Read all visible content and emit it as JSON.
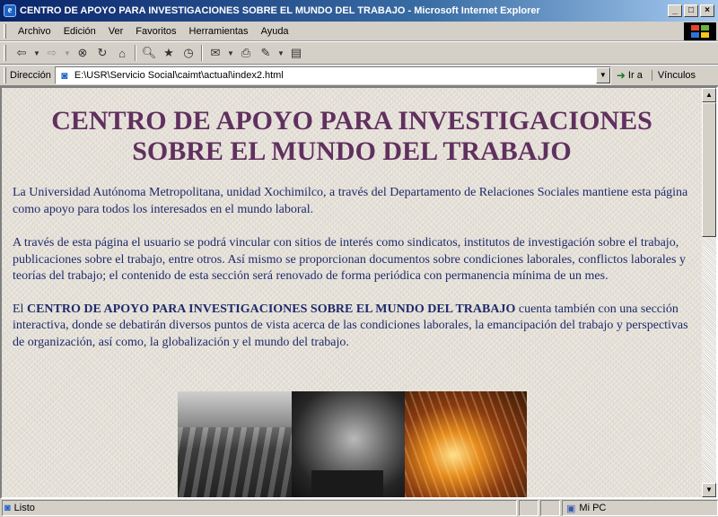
{
  "window": {
    "title": "CENTRO DE APOYO PARA INVESTIGACIONES SOBRE EL MUNDO DEL TRABAJO - Microsoft Internet Explorer",
    "buttons": {
      "minimize": "_",
      "maximize": "□",
      "close": "×"
    }
  },
  "menu": [
    "Archivo",
    "Edición",
    "Ver",
    "Favoritos",
    "Herramientas",
    "Ayuda"
  ],
  "toolbar": {
    "icons": [
      "back-icon",
      "forward-icon",
      "stop-icon",
      "refresh-icon",
      "home-icon",
      "search-icon",
      "favorites-icon",
      "history-icon",
      "mail-icon",
      "print-icon",
      "edit-icon",
      "discuss-icon"
    ]
  },
  "address": {
    "label": "Dirección",
    "value": "E:\\USR\\Servicio Social\\caimt\\actual\\index2.html",
    "go_label": "Ir a",
    "links_label": "Vínculos"
  },
  "page": {
    "heading": "CENTRO DE APOYO PARA INVESTIGACIONES SOBRE EL MUNDO DEL TRABAJO",
    "paragraph1": "La Universidad Autónoma Metropolitana, unidad Xochimilco, a través del Departamento de Relaciones Sociales mantiene esta página como apoyo para todos los interesados en el mundo laboral.",
    "paragraph2": "A través de esta página el usuario se podrá vincular con sitios de interés como sindicatos, institutos de investigación sobre el trabajo, publicaciones sobre el trabajo, entre otros. Así mismo se proporcionan documentos sobre condiciones laborales, conflictos laborales y teorías del trabajo; el contenido de esta sección será renovado de forma periódica con permanencia mínima de un mes.",
    "paragraph3_prefix": "El ",
    "paragraph3_strong": "CENTRO DE APOYO PARA INVESTIGACIONES SOBRE EL MUNDO DEL TRABAJO",
    "paragraph3_suffix": " cuenta también con una sección interactiva, donde se debatirán diversos puntos de vista acerca de las condiciones laborales, la emancipación del trabajo y perspectivas de organización, así como, la globalización y el mundo del trabajo."
  },
  "status": {
    "text": "Listo",
    "zone": "Mi PC"
  },
  "colors": {
    "heading": "#60305e",
    "body_text": "#1e2a6a",
    "titlebar_start": "#0a246a",
    "titlebar_end": "#a6caf0"
  }
}
